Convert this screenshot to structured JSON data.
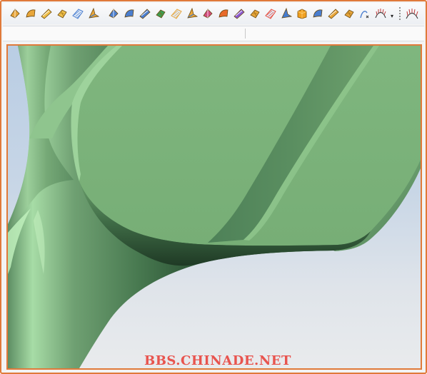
{
  "toolbar": {
    "tools": [
      {
        "name": "rotate-view-icon",
        "color": "#e8a63a"
      },
      {
        "name": "surface-patch-icon",
        "color": "#e8a63a"
      },
      {
        "name": "sweep-surface-icon",
        "color": "#f0c04a"
      },
      {
        "name": "loft-surface-icon",
        "color": "#f0c04a"
      },
      {
        "name": "net-surface-icon",
        "color": "#4a7ecf"
      },
      {
        "name": "rule-surface-icon",
        "color": "#e8a63a"
      },
      {
        "name": "extend-surface-icon",
        "color": "#4a7ecf"
      },
      {
        "name": "offset-surface-icon",
        "color": "#4a7ecf"
      },
      {
        "name": "fill-surface-icon",
        "color": "#4a7ecf"
      },
      {
        "name": "blend-surface-icon",
        "color": "#3aa055"
      },
      {
        "name": "trim-surface-icon",
        "color": "#e8a63a"
      },
      {
        "name": "untrim-surface-icon",
        "color": "#e8a63a"
      },
      {
        "name": "split-surface-icon",
        "color": "#d04a7e"
      },
      {
        "name": "fold-surface-icon",
        "color": "#e86a2a"
      },
      {
        "name": "flatten-surface-icon",
        "color": "#8a5ad0"
      },
      {
        "name": "convert-surface-icon",
        "color": "#e8a63a"
      },
      {
        "name": "knit-surface-icon",
        "color": "#e84a3a"
      },
      {
        "name": "project-surface-icon",
        "color": "#4a7ecf"
      },
      {
        "name": "solid-box-icon",
        "color": "#f0a020"
      },
      {
        "name": "thicken-surface-icon",
        "color": "#4a7ecf"
      },
      {
        "name": "shell-icon",
        "color": "#e8a63a"
      },
      {
        "name": "bend-surface-icon",
        "color": "#e8a63a"
      },
      {
        "name": "sketch-curve-icon",
        "color": "#4a7ecf"
      },
      {
        "name": "curvature-comb-icon",
        "color": "#c03a3a"
      }
    ],
    "overflow_arrow": "▾"
  },
  "viewport": {
    "background_top": "#b9cde4",
    "background_bottom": "#e9ebed",
    "model_color": "#7fb47f",
    "model_shadow": "#3e6a48",
    "model_highlight": "#c4f0c0",
    "border_color": "#e07a3a"
  },
  "watermark": {
    "text": "BBS.CHINADE.NET",
    "color": "#e8544e"
  }
}
